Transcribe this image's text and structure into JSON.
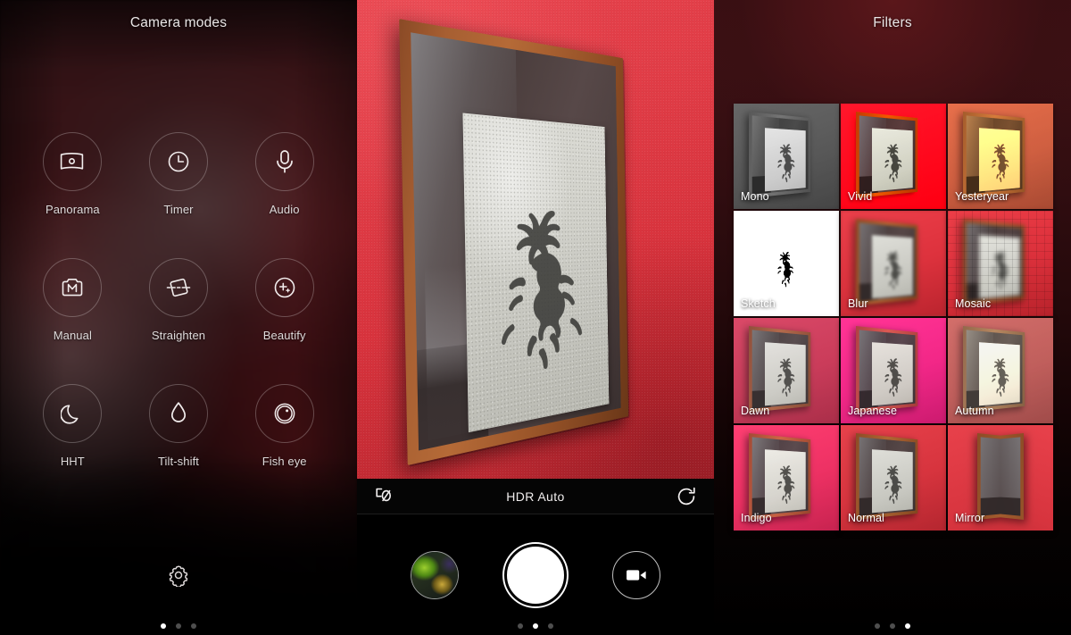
{
  "left_panel": {
    "title": "Camera modes",
    "modes": [
      {
        "label": "Panorama",
        "icon": "panorama-icon"
      },
      {
        "label": "Timer",
        "icon": "timer-clock-icon"
      },
      {
        "label": "Audio",
        "icon": "microphone-icon"
      },
      {
        "label": "Manual",
        "icon": "manual-m-camera-icon"
      },
      {
        "label": "Straighten",
        "icon": "straighten-icon"
      },
      {
        "label": "Beautify",
        "icon": "beautify-sparkle-icon"
      },
      {
        "label": "HHT",
        "icon": "moon-icon"
      },
      {
        "label": "Tilt-shift",
        "icon": "water-drop-icon"
      },
      {
        "label": "Fish eye",
        "icon": "fisheye-lens-icon"
      }
    ],
    "settings_icon": "gear-icon",
    "pager": {
      "count": 3,
      "active_index": 0
    }
  },
  "center_panel": {
    "controls": {
      "flash_icon": "flash-off-icon",
      "hdr_label": "HDR Auto",
      "switch_camera_icon": "switch-camera-icon",
      "thumbnail_icon": "last-photo-thumbnail",
      "shutter_icon": "shutter-button",
      "video_icon": "video-camera-icon"
    },
    "pager": {
      "count": 3,
      "active_index": 1
    }
  },
  "right_panel": {
    "title": "Filters",
    "selected_filter": "Normal",
    "filters": [
      {
        "label": "Mono",
        "fx": "fx-mono",
        "extra": ""
      },
      {
        "label": "Vivid",
        "fx": "fx-vivid",
        "extra": ""
      },
      {
        "label": "Yesteryear",
        "fx": "fx-yester",
        "extra": ""
      },
      {
        "label": "Sketch",
        "fx": "fx-sketch",
        "extra": "sketchwhite"
      },
      {
        "label": "Blur",
        "fx": "fx-blur",
        "extra": ""
      },
      {
        "label": "Mosaic",
        "fx": "fx-mosaic",
        "extra": "mosaic"
      },
      {
        "label": "Dawn",
        "fx": "fx-dawn",
        "extra": ""
      },
      {
        "label": "Japanese",
        "fx": "fx-japan",
        "extra": ""
      },
      {
        "label": "Autumn",
        "fx": "fx-autumn",
        "extra": ""
      },
      {
        "label": "Indigo",
        "fx": "fx-indigo",
        "extra": ""
      },
      {
        "label": "Normal",
        "fx": "fx-normal",
        "extra": ""
      },
      {
        "label": "Mirror",
        "fx": "fx-mirror",
        "extra": "mirror"
      }
    ],
    "pager": {
      "count": 3,
      "active_index": 2
    }
  },
  "colors": {
    "wall_red": "#d8333d",
    "panel_dark": "#000000",
    "accent_white": "#ffffff",
    "filters_bg": "#3a1013"
  }
}
